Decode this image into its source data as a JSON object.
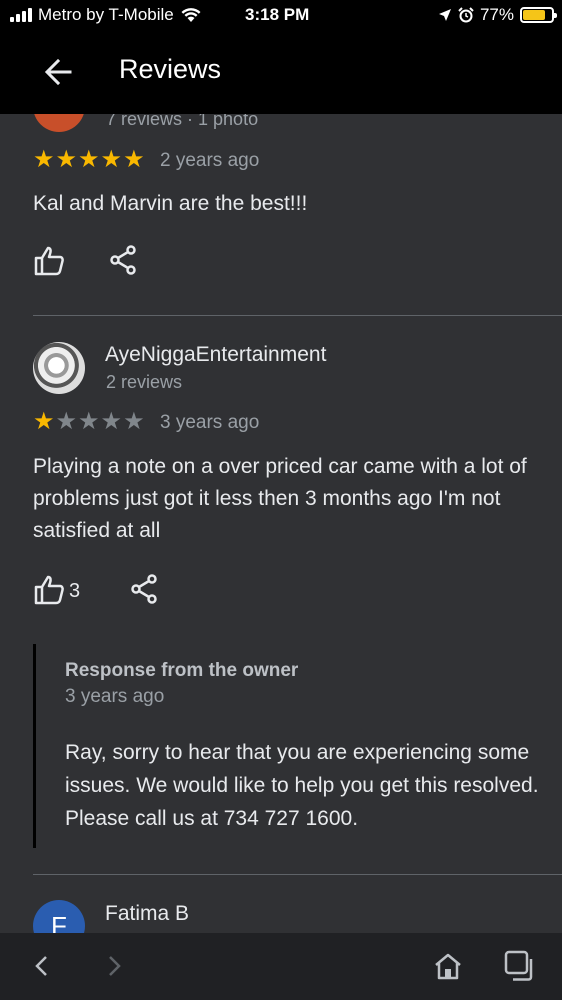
{
  "status": {
    "carrier": "Metro by T-Mobile",
    "time": "3:18 PM",
    "battery": "77%",
    "battery_level": 0.77,
    "battery_color": "#f5c518"
  },
  "appbar": {
    "title": "Reviews",
    "back_icon": "arrow-left-icon"
  },
  "reviews": [
    {
      "meta": "7 reviews · 1 photo",
      "rating": 5,
      "date": "2 years ago",
      "text": "Kal and Marvin are the best!!!",
      "likes": ""
    },
    {
      "name": "AyeNiggaEntertainment",
      "meta": "2 reviews",
      "rating": 1,
      "date": "3 years ago",
      "text": "Playing a note on a over priced car came with a lot of problems just got it less then 3 months ago I'm not satisfied at all",
      "likes": "3",
      "response": {
        "title": "Response from the owner",
        "date": "3 years ago",
        "text": "Ray, sorry to hear that you are experiencing some issues. We would like to help you get this resolved. Please call us at 734 727 1600."
      }
    },
    {
      "name": "Fatima B",
      "avatar_letter": "F"
    }
  ],
  "colors": {
    "star_on": "#f9b800",
    "star_off": "#80868b",
    "background": "#303134"
  }
}
